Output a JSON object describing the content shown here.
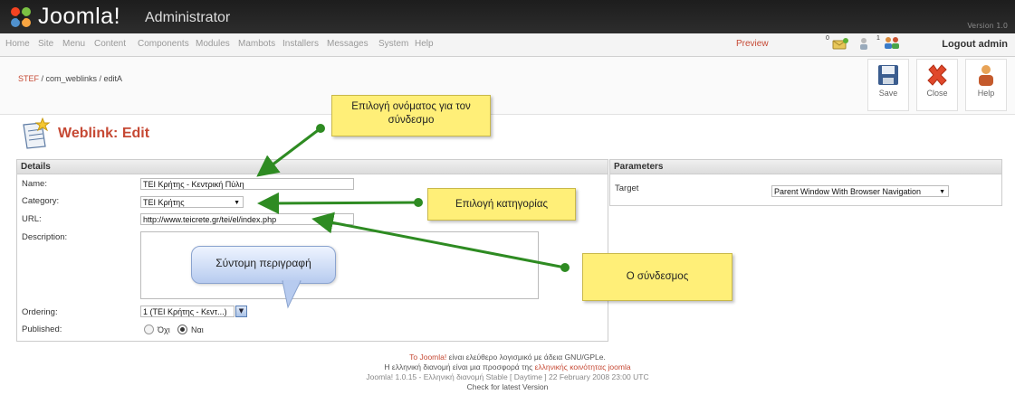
{
  "header": {
    "logo_text": "Joomla!",
    "logo_sub": "Administrator",
    "version": "Version 1.0"
  },
  "menubar": {
    "items": [
      "Home",
      "Site",
      "Menu",
      "Content",
      "Components",
      "Modules",
      "Mambots",
      "Installers",
      "Messages",
      "System",
      "Help"
    ],
    "preview": "Preview",
    "messages_count": "0",
    "users_count": "1",
    "logout": "Logout admin"
  },
  "toolbar": {
    "path_site": "STEF",
    "path_rest": " / com_weblinks / editA",
    "save_label": "Save",
    "close_label": "Close",
    "help_label": "Help"
  },
  "page": {
    "title": "Weblink: Edit"
  },
  "details": {
    "heading": "Details",
    "name_label": "Name:",
    "name_value": "ΤΕΙ Κρήτης - Κεντρική Πύλη",
    "category_label": "Category:",
    "category_value": "ΤΕΙ Κρήτης",
    "url_label": "URL:",
    "url_value": "http://www.teicrete.gr/tei/el/index.php",
    "description_label": "Description:",
    "ordering_label": "Ordering:",
    "ordering_value": "1 (ΤΕΙ Κρήτης - Κεντ...)",
    "published_label": "Published:",
    "published_no": "Όχι",
    "published_yes": "Ναι",
    "published_selected": "Ναι"
  },
  "parameters": {
    "heading": "Parameters",
    "target_label": "Target",
    "target_value": "Parent Window With Browser Navigation"
  },
  "callouts": {
    "name_note": "Επιλογή ονόματος για τον σύνδεσμο",
    "category_note": "Επιλογή κατηγορίας",
    "url_note": "Ο σύνδεσμος",
    "description_note": "Σύντομη περιγραφή"
  },
  "footer": {
    "line1_link": "To Joomla!",
    "line1_rest": " είναι ελεύθερο λογισμικό με άδεια GNU/GPLe.",
    "line2_text": "Η ελληνική διανομή είναι μια προσφορά της ",
    "line2_link": "ελληνικής κοινότητας joomla",
    "line3": "Joomla! 1.0.15 - Ελληνική διανομή Stable [ Daytime ] 22 February 2008 23:00 UTC",
    "line4": "Check for latest Version"
  },
  "colors": {
    "accent": "#c64934",
    "arrow": "#2e8b22",
    "callout": "#ffef78"
  }
}
